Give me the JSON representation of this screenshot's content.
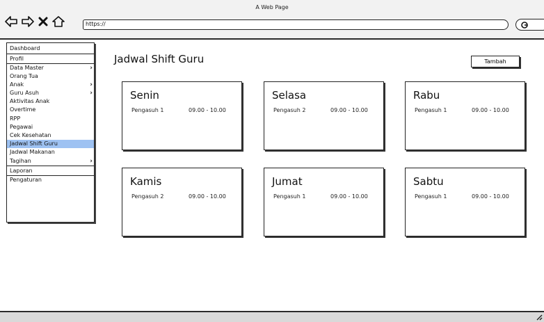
{
  "window": {
    "title": "A Web Page"
  },
  "browser": {
    "url": "https://"
  },
  "icons": {
    "back": "back-arrow-icon",
    "forward": "forward-arrow-icon",
    "stop": "close-icon",
    "home": "home-icon",
    "search": "search-icon"
  },
  "sidebar": {
    "items": [
      {
        "label": "Dashboard",
        "submenu": false
      },
      {
        "label": "Profil",
        "submenu": false
      },
      {
        "label": "Data Master",
        "submenu": true
      },
      {
        "label": "Orang Tua",
        "submenu": false
      },
      {
        "label": "Anak",
        "submenu": true
      },
      {
        "label": "Guru Asuh",
        "submenu": true
      },
      {
        "label": "Aktivitas Anak",
        "submenu": false
      },
      {
        "label": "Overtime",
        "submenu": false
      },
      {
        "label": "RPP",
        "submenu": false
      },
      {
        "label": "Pegawai",
        "submenu": false
      },
      {
        "label": "Cek Kesehatan",
        "submenu": false
      },
      {
        "label": "Jadwal Shift Guru",
        "submenu": false,
        "active": true
      },
      {
        "label": "Jadwal Makanan",
        "submenu": false
      },
      {
        "label": "Tagihan",
        "submenu": true
      },
      {
        "label": "Laporan",
        "submenu": false
      },
      {
        "label": "Pengaturan",
        "submenu": false
      }
    ],
    "chevron": "›"
  },
  "main": {
    "title": "Jadwal Shift Guru",
    "add_label": "Tambah",
    "cards": [
      {
        "day": "Senin",
        "person": "Pengasuh 1",
        "time": "09.00 - 10.00"
      },
      {
        "day": "Selasa",
        "person": "Pengasuh 2",
        "time": "09.00 - 10.00"
      },
      {
        "day": "Rabu",
        "person": "Pengasuh 1",
        "time": "09.00 - 10.00"
      },
      {
        "day": "Kamis",
        "person": "Pengasuh 2",
        "time": "09.00 - 10.00"
      },
      {
        "day": "Jumat",
        "person": "Pengasuh 1",
        "time": "09.00 - 10.00"
      },
      {
        "day": "Sabtu",
        "person": "Pengasuh 1",
        "time": "09.00 - 10.00"
      }
    ]
  },
  "colors": {
    "active_item": "#9ec2f2",
    "chrome_bg": "#f2f2f2",
    "status_bar": "#d9d9d9",
    "border": "#222222"
  }
}
